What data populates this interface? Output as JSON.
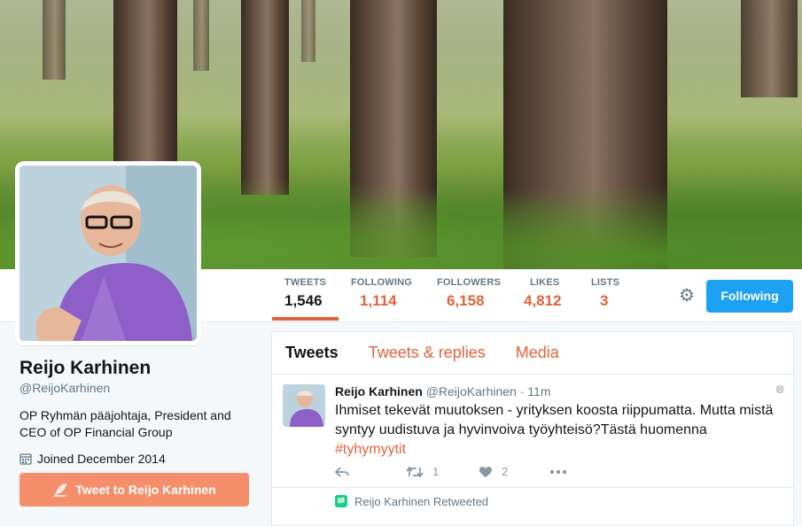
{
  "profile": {
    "name": "Reijo Karhinen",
    "handle": "@ReijoKarhinen",
    "bio": "OP Ryhmän pääjohtaja, President and CEO of OP Financial Group",
    "joined": "Joined December 2014",
    "tweet_to_label": "Tweet to Reijo Karhinen"
  },
  "stats": [
    {
      "label": "TWEETS",
      "value": "1,546"
    },
    {
      "label": "FOLLOWING",
      "value": "1,114"
    },
    {
      "label": "FOLLOWERS",
      "value": "6,158"
    },
    {
      "label": "LIKES",
      "value": "4,812"
    },
    {
      "label": "LISTS",
      "value": "3"
    }
  ],
  "follow_button": "Following",
  "tabs": [
    "Tweets",
    "Tweets & replies",
    "Media"
  ],
  "tweet": {
    "name": "Reijo Karhinen",
    "handle": "@ReijoKarhinen",
    "time": "· 11m",
    "text": "Ihmiset tekevät muutoksen - yrityksen koosta riippumatta. Mutta mistä syntyy uudistuva ja hyvinvoiva työyhteisö?Tästä  huomenna",
    "hashtag": "#tyhymyytit",
    "retweets": "1",
    "likes": "2"
  },
  "retweeted_label": "Reijo Karhinen Retweeted",
  "colors": {
    "accent": "#e0633c",
    "follow_blue": "#1da1f2",
    "tweet_to_bg": "#f58e6a"
  },
  "icons": [
    "gear-icon",
    "calendar-icon",
    "quill-icon",
    "globe-icon",
    "reply-icon",
    "retweet-icon",
    "heart-icon",
    "more-icon"
  ]
}
